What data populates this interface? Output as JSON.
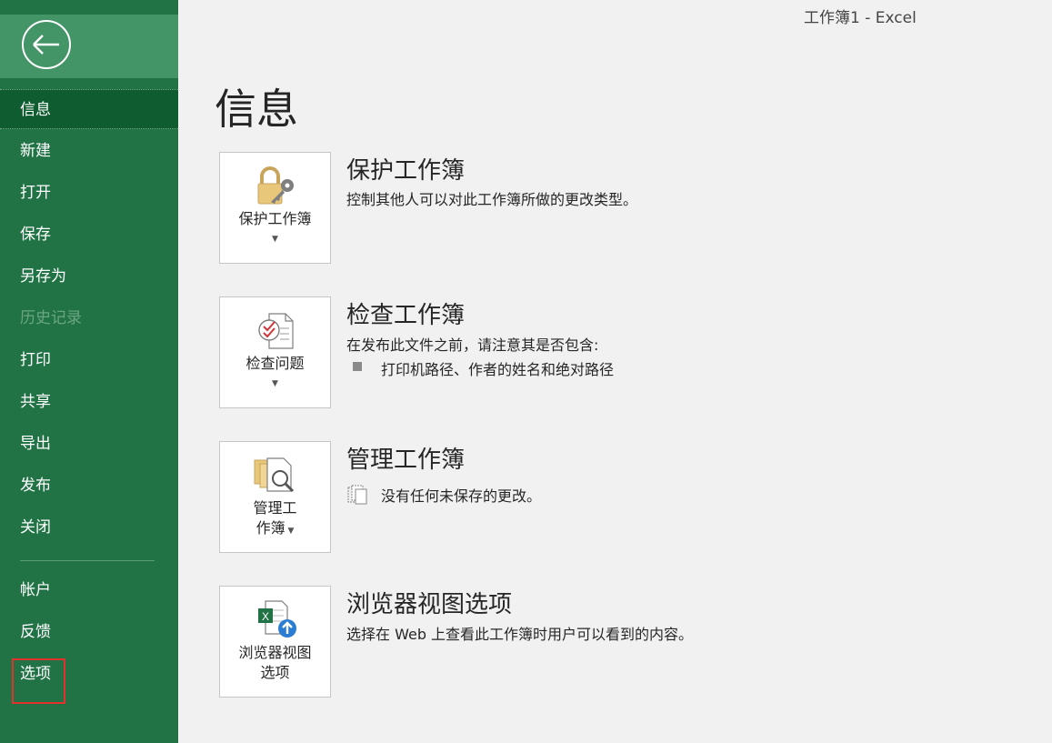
{
  "window_title": "工作簿1  -  Excel",
  "page_title": "信息",
  "sidebar": {
    "items": [
      {
        "label": "信息",
        "state": "active"
      },
      {
        "label": "新建"
      },
      {
        "label": "打开"
      },
      {
        "label": "保存"
      },
      {
        "label": "另存为"
      },
      {
        "label": "历史记录",
        "state": "disabled"
      },
      {
        "label": "打印"
      },
      {
        "label": "共享"
      },
      {
        "label": "导出"
      },
      {
        "label": "发布"
      },
      {
        "label": "关闭"
      },
      {
        "label": "帐户"
      },
      {
        "label": "反馈"
      },
      {
        "label": "选项",
        "state": "highlighted"
      }
    ]
  },
  "sections": {
    "protect": {
      "tile_label": "保护工作簿",
      "title": "保护工作簿",
      "description": "控制其他人可以对此工作簿所做的更改类型。",
      "icon": "lock-key-icon"
    },
    "inspect": {
      "tile_label": "检查问题",
      "title": "检查工作簿",
      "description": "在发布此文件之前，请注意其是否包含:",
      "bullet": "打印机路径、作者的姓名和绝对路径",
      "icon": "inspect-document-icon"
    },
    "manage": {
      "tile_label_line1": "管理工",
      "tile_label_line2": "作簿",
      "title": "管理工作簿",
      "status": "没有任何未保存的更改。",
      "icon": "manage-workbook-icon"
    },
    "browser": {
      "tile_label_line1": "浏览器视图",
      "tile_label_line2": "选项",
      "title": "浏览器视图选项",
      "description": "选择在 Web 上查看此工作簿时用户可以看到的内容。",
      "icon": "excel-web-icon"
    }
  },
  "colors": {
    "sidebar": "#217346",
    "sidebar_active": "#0e5c2f",
    "back_area": "#439467",
    "highlight": "#e3322d",
    "background": "#f1f1f1"
  }
}
